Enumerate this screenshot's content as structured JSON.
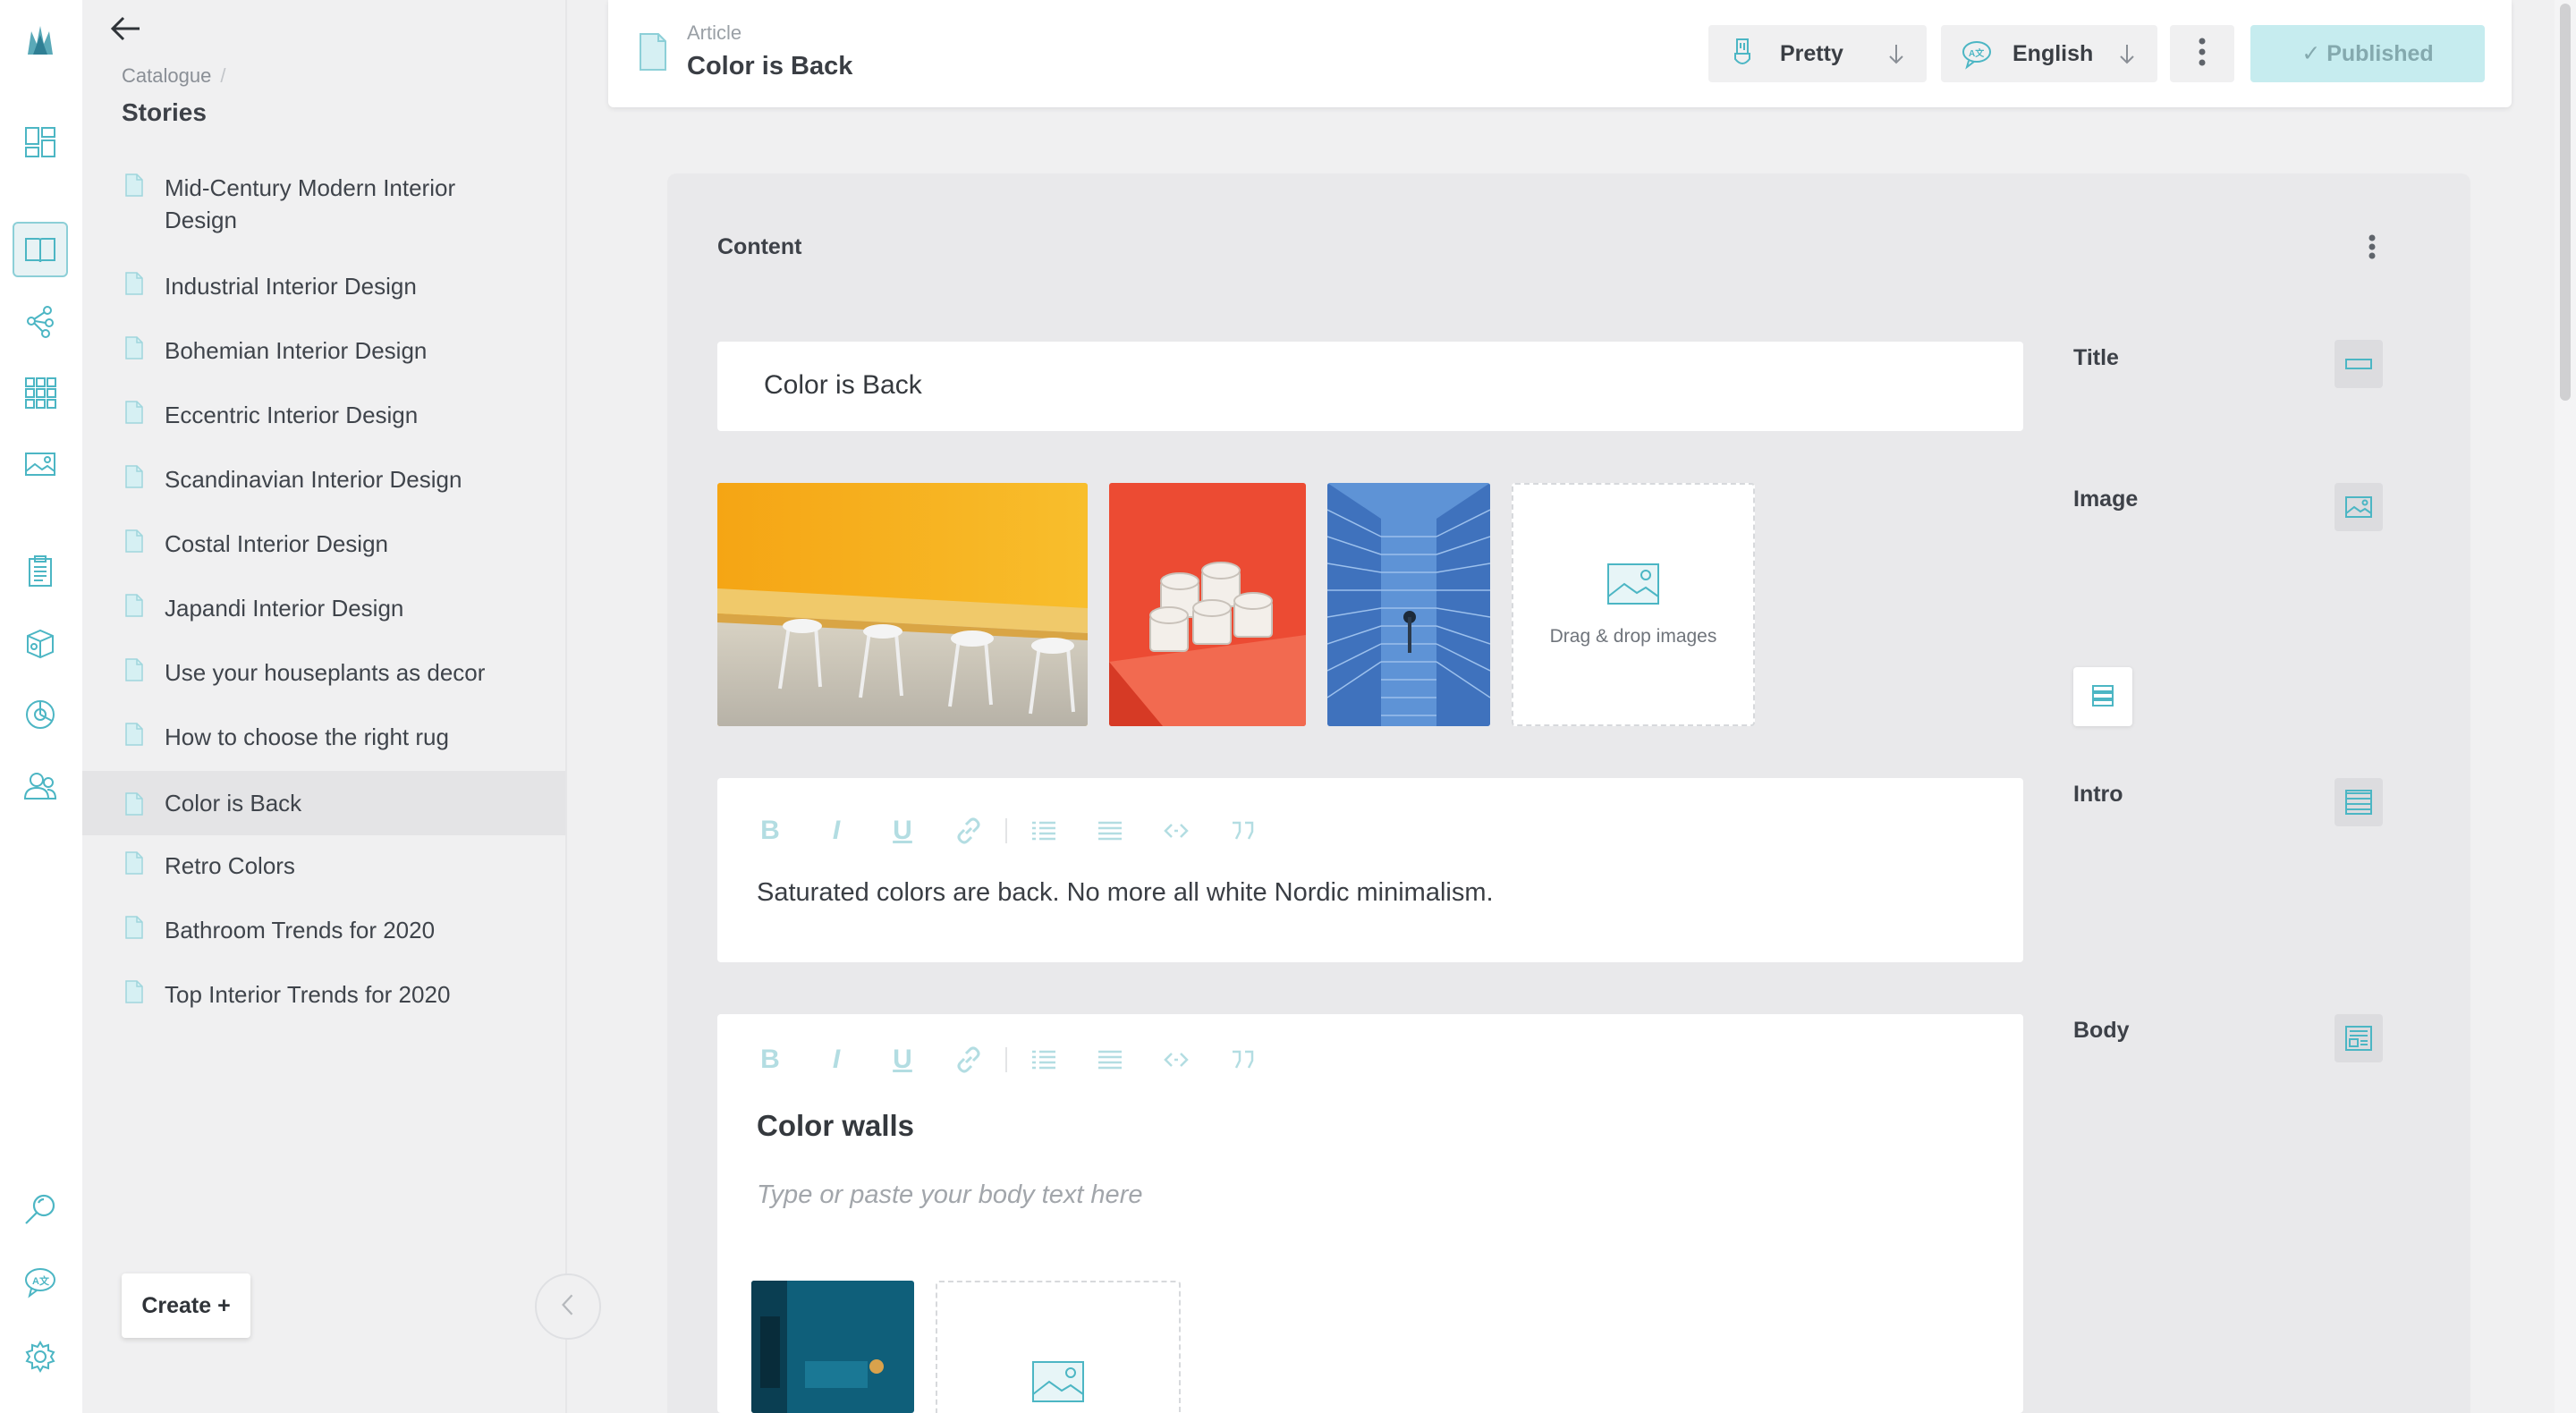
{
  "sidebar": {
    "breadcrumb": "Catalogue",
    "breadcrumb_sep": "/",
    "title": "Stories",
    "items": [
      {
        "label": "Mid-Century Modern Interior Design"
      },
      {
        "label": "Industrial Interior Design"
      },
      {
        "label": "Bohemian Interior Design"
      },
      {
        "label": "Eccentric Interior Design"
      },
      {
        "label": "Scandinavian Interior Design"
      },
      {
        "label": "Costal Interior Design"
      },
      {
        "label": "Japandi Interior Design"
      },
      {
        "label": "Use your houseplants as decor"
      },
      {
        "label": "How to choose the right rug"
      },
      {
        "label": "Color is Back"
      },
      {
        "label": "Retro Colors"
      },
      {
        "label": "Bathroom Trends for 2020"
      },
      {
        "label": "Top Interior Trends for 2020"
      }
    ],
    "selected_index": 9,
    "create_label": "Create +"
  },
  "header": {
    "kind": "Article",
    "title": "Color is Back",
    "variant_select": "Pretty",
    "language_select": "English",
    "publish_label": "✓ Published"
  },
  "content": {
    "label": "Content",
    "title_value": "Color is Back",
    "dropzone_label": "Drag & drop images",
    "intro_text": "Saturated colors are back. No more all white Nordic minimalism.",
    "body_heading": "Color walls",
    "body_placeholder": "Type or paste your body text here"
  },
  "fields": {
    "title": "Title",
    "image": "Image",
    "intro": "Intro",
    "body": "Body"
  },
  "colors": {
    "accent": "#4cb6c4",
    "accent_light": "#b3dde2",
    "publish_bg": "#c6ecef",
    "selected_row": "#e4e4e6"
  },
  "icons": {
    "rail": [
      "logo-icon",
      "dashboard-icon",
      "book-icon",
      "graph-icon",
      "grid-icon",
      "image-icon",
      "clipboard-icon",
      "cube-icon",
      "chart-icon",
      "users-icon",
      "search-icon",
      "translate-icon",
      "gear-icon"
    ]
  }
}
